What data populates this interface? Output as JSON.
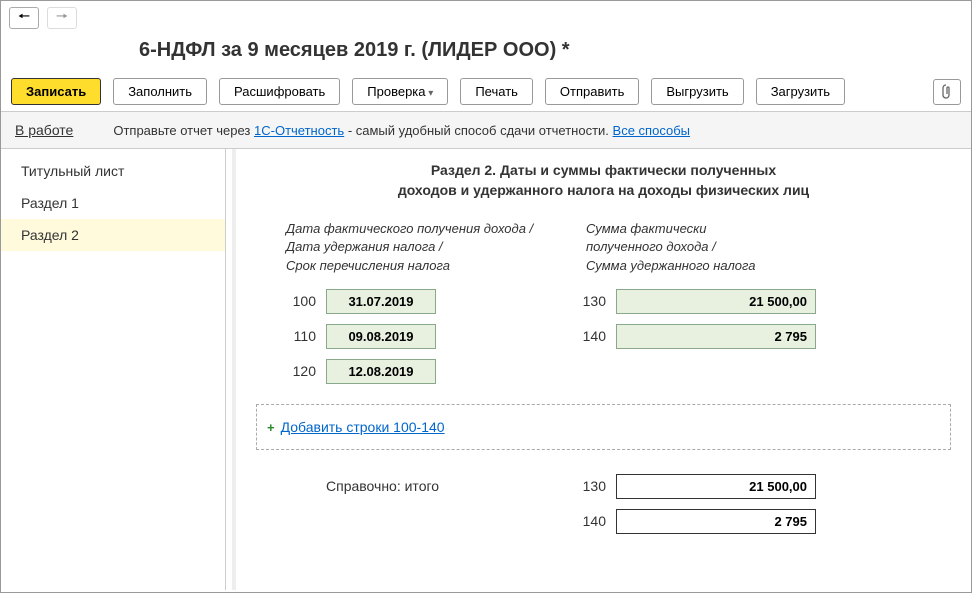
{
  "title": "6-НДФЛ за 9 месяцев 2019 г. (ЛИДЕР ООО) *",
  "toolbar": {
    "save": "Записать",
    "fill": "Заполнить",
    "decrypt": "Расшифровать",
    "check": "Проверка",
    "print": "Печать",
    "send": "Отправить",
    "export": "Выгрузить",
    "import": "Загрузить"
  },
  "status": "В работе",
  "info": {
    "prefix": "Отправьте отчет через ",
    "link1": "1С-Отчетность",
    "mid": " - самый удобный способ сдачи отчетности. ",
    "link2": "Все способы"
  },
  "sidebar": [
    "Титульный лист",
    "Раздел 1",
    "Раздел 2"
  ],
  "section": {
    "title_l1": "Раздел 2.  Даты и суммы фактически полученных",
    "title_l2": "доходов и удержанного налога на доходы физических лиц",
    "col_left_l1": "Дата фактического получения дохода /",
    "col_left_l2": "Дата удержания налога /",
    "col_left_l3": "Срок перечисления налога",
    "col_right_l1": "Сумма фактически",
    "col_right_l2": "полученного дохода /",
    "col_right_l3": "Сумма удержанного налога"
  },
  "rows": {
    "r100": {
      "num": "100",
      "date": "31.07.2019"
    },
    "r110": {
      "num": "110",
      "date": "09.08.2019"
    },
    "r120": {
      "num": "120",
      "date": "12.08.2019"
    },
    "r130": {
      "num": "130",
      "amount": "21 500,00"
    },
    "r140": {
      "num": "140",
      "amount": "2 795"
    }
  },
  "add_link": "Добавить строки 100-140",
  "totals": {
    "label": "Справочно: итого",
    "r130": {
      "num": "130",
      "amount": "21 500,00"
    },
    "r140": {
      "num": "140",
      "amount": "2 795"
    }
  }
}
